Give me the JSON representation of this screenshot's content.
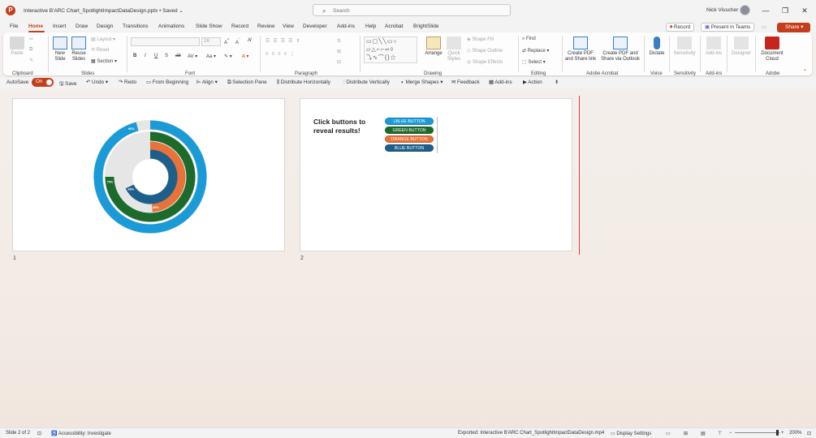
{
  "window": {
    "app_icon": "P",
    "title": "Interactive B'ARC Chart_SpotlightImpactDataDesign.pptx • Saved ⌄",
    "search_placeholder": "Search",
    "user_name": "Nick Visscher",
    "minimize": "—",
    "restore": "❐",
    "close": "✕"
  },
  "menu": {
    "tabs": [
      "File",
      "Home",
      "Insert",
      "Draw",
      "Design",
      "Transitions",
      "Animations",
      "Slide Show",
      "Record",
      "Review",
      "View",
      "Developer",
      "Add-ins",
      "Help",
      "Acrobat",
      "BrightSlide"
    ],
    "record_label": "Record",
    "present_label": "Present in Teams",
    "share_label": "Share"
  },
  "ribbon": {
    "clipboard": {
      "paste": "Paste",
      "group": "Clipboard"
    },
    "slides": {
      "new_slide": "New Slide",
      "reuse_slides": "Reuse Slides",
      "layout": "Layout",
      "reset": "Reset",
      "section": "Section",
      "group": "Slides"
    },
    "font": {
      "size": "28",
      "group": "Font"
    },
    "paragraph": {
      "group": "Paragraph"
    },
    "drawing": {
      "arrange": "Arrange",
      "quick_styles": "Quick Styles",
      "shape_fill": "Shape Fill",
      "shape_outline": "Shape Outline",
      "shape_effects": "Shape Effects",
      "group": "Drawing"
    },
    "editing": {
      "find": "Find",
      "replace": "Replace",
      "select": "Select",
      "group": "Editing"
    },
    "acrobat": {
      "create_pdf_share": "Create PDF and Share link",
      "create_pdf_outlook": "Create PDF and Share via Outlook",
      "group": "Adobe Acrobat"
    },
    "voice": {
      "dictate": "Dictate",
      "group": "Voice"
    },
    "sensitivity": {
      "label": "Sensitivity",
      "group": "Sensitivity"
    },
    "addins": {
      "label": "Add-ins",
      "group": "Add-ins"
    },
    "designer": {
      "label": "Designer"
    },
    "adobe": {
      "document_cloud": "Document Cloud",
      "group": "Adobe"
    }
  },
  "qat": {
    "autosave": "AutoSave",
    "toggle": "On",
    "save": "Save",
    "undo": "Undo",
    "redo": "Redo",
    "from_beginning": "From Beginning",
    "align": "Align",
    "selection_pane": "Selection Pane",
    "distribute_h": "Distribute Horizontally",
    "distribute_v": "Distribute Vertically",
    "merge_shapes": "Merge Shapes",
    "feedback": "Feedback",
    "add_ins": "Add-ins",
    "action": "Action"
  },
  "slides": [
    {
      "number": "1",
      "chart_labels": [
        "68%",
        "49%",
        "75%",
        "96%"
      ]
    },
    {
      "number": "2",
      "heading_line1": "Click buttons to",
      "heading_line2": "reveal results!",
      "buttons": [
        "LBLUE BUTTON",
        "GREEN BUTTON",
        "ORANGE BUTTON",
        "BLUE BUTTON"
      ]
    }
  ],
  "colors": {
    "accent": "#c43e1c",
    "lblue": "#1a9bd7",
    "green": "#1d6b2c",
    "orange": "#e8733a",
    "blue": "#1d5f8a",
    "track": "#e6e6e6"
  },
  "chart_data": {
    "type": "pie",
    "series": [
      {
        "color": "lblue",
        "value": 96
      },
      {
        "color": "green",
        "value": 75
      },
      {
        "color": "orange",
        "value": 49
      },
      {
        "color": "blue",
        "value": 68
      }
    ]
  },
  "status": {
    "slide_info": "Slide 2 of 2",
    "accessibility": "Accessibility: Investigate",
    "exported": "Exported: Interactive B'ARC Chart_SpotlightImpactDataDesign.mp4",
    "display_settings": "Display Settings",
    "zoom": "200%"
  }
}
